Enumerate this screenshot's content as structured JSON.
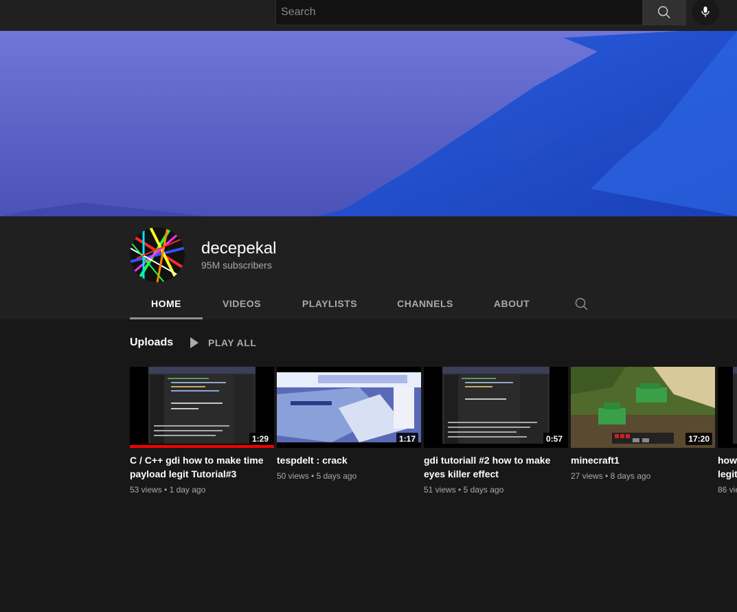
{
  "search": {
    "placeholder": "Search"
  },
  "channel": {
    "name": "decepekal",
    "subscribers": "95M subscribers"
  },
  "tabs": [
    {
      "label": "HOME",
      "active": true
    },
    {
      "label": "VIDEOS",
      "active": false
    },
    {
      "label": "PLAYLISTS",
      "active": false
    },
    {
      "label": "CHANNELS",
      "active": false
    },
    {
      "label": "ABOUT",
      "active": false
    }
  ],
  "shelf": {
    "title": "Uploads",
    "play_all": "PLAY ALL",
    "videos": [
      {
        "title": "C / C++ gdi how to make time payload legit Tutorial#3",
        "views": "53 views",
        "age": "1 day ago",
        "duration": "1:29",
        "watched_fraction": 1.0
      },
      {
        "title": "tespdelt : crack",
        "views": "50 views",
        "age": "5 days ago",
        "duration": "1:17"
      },
      {
        "title": "gdi tutoriall #2 how to make eyes killer effect",
        "views": "51 views",
        "age": "5 days ago",
        "duration": "0:57"
      },
      {
        "title": "minecraft1",
        "views": "27 views",
        "age": "8 days ago",
        "duration": "17:20"
      },
      {
        "title": "how",
        "title_line2": "legit",
        "views": "86 vie"
      }
    ]
  },
  "colors": {
    "accent_red": "#ff0000",
    "bg": "#181818",
    "header": "#202020",
    "banner": "#5a62c8"
  }
}
